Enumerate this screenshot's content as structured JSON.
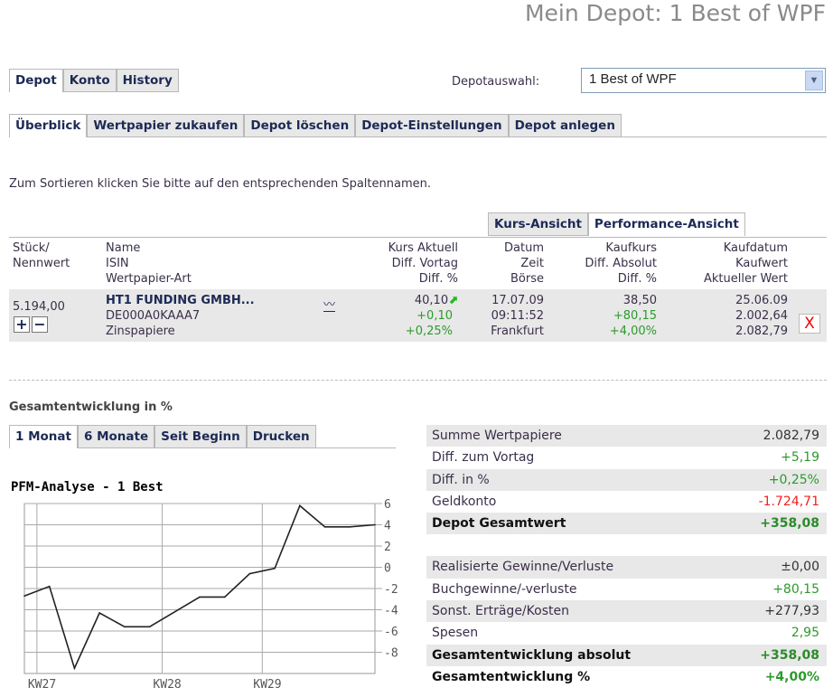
{
  "title": "Mein Depot: 1 Best of WPF",
  "main_tabs": [
    "Depot",
    "Konto",
    "History"
  ],
  "depot_select": {
    "label": "Depotauswahl:",
    "value": "1 Best of WPF"
  },
  "sub_tabs": [
    "Überblick",
    "Wertpapier zukaufen",
    "Depot löschen",
    "Depot-Einstellungen",
    "Depot anlegen"
  ],
  "hint": "Zum Sortieren klicken Sie bitte auf den entsprechenden Spaltennamen.",
  "view_tabs": [
    "Kurs-Ansicht",
    "Performance-Ansicht"
  ],
  "headers": {
    "stueck": [
      "Stück/",
      "Nennwert"
    ],
    "name": [
      "Name",
      "ISIN",
      "Wertpapier-Art"
    ],
    "kurs": [
      "Kurs Aktuell",
      "Diff. Vortag",
      "Diff. %"
    ],
    "datum": [
      "Datum",
      "Zeit",
      "Börse"
    ],
    "kaufkurs": [
      "Kaufkurs",
      "Diff. Absolut",
      "Diff. %"
    ],
    "kaufdatum": [
      "Kaufdatum",
      "Kaufwert",
      "Aktueller Wert"
    ]
  },
  "position": {
    "stueck": "5.194,00",
    "name": "HT1 FUNDING GMBH...",
    "isin": "DE000A0KAAA7",
    "art": "Zinspapiere",
    "kurs": "40,10",
    "diff_vortag": "+0,10",
    "diff_pct": "+0,25%",
    "datum": "17.07.09",
    "zeit": "09:11:52",
    "boerse": "Frankfurt",
    "kaufkurs": "38,50",
    "diff_abs": "+80,15",
    "diff_pct2": "+4,00%",
    "kaufdatum": "25.06.09",
    "kaufwert": "2.002,64",
    "aktueller_wert": "2.082,79",
    "plus": "+",
    "minus": "−",
    "delete": "X"
  },
  "gesamt_heading": "Gesamtentwicklung in %",
  "period_tabs": [
    "1 Monat",
    "6 Monate",
    "Seit Beginn",
    "Drucken"
  ],
  "summary1": [
    {
      "label": "Summe Wertpapiere",
      "value": "2.082,79",
      "color": "#333333"
    },
    {
      "label": "Diff. zum Vortag",
      "value": "+5,19",
      "color": "#2c9a2c"
    },
    {
      "label": "Diff. in %",
      "value": "+0,25%",
      "color": "#2c9a2c"
    },
    {
      "label": "Geldkonto",
      "value": "-1.724,71",
      "color": "#f02020"
    },
    {
      "label": "Depot Gesamtwert",
      "value": "+358,08",
      "color": "#2c8a2c",
      "bold": true
    }
  ],
  "summary2": [
    {
      "label": "Realisierte Gewinne/Verluste",
      "value": "±0,00",
      "color": "#333333"
    },
    {
      "label": "Buchgewinne/-verluste",
      "value": "+80,15",
      "color": "#2c9a2c"
    },
    {
      "label": "Sonst. Erträge/Kosten",
      "value": "+277,93",
      "color": "#333333"
    },
    {
      "label": "Spesen",
      "value": "2,95",
      "color": "#2c9a2c"
    },
    {
      "label": "Gesamtentwicklung absolut",
      "value": "+358,08",
      "color": "#2c8a2c",
      "bold": true
    },
    {
      "label": "Gesamtentwicklung %",
      "value": "+4,00%",
      "color": "#2c9a2c",
      "bold": true
    }
  ],
  "chart_data": {
    "type": "line",
    "title": "PFM-Analyse - 1 Best",
    "x": [
      0,
      1,
      2,
      3,
      4,
      5,
      7,
      8,
      9,
      10,
      11,
      12,
      13,
      14
    ],
    "y": [
      -2.7,
      -1.8,
      -9.5,
      -4.3,
      -5.6,
      -5.6,
      -2.8,
      -2.8,
      -0.6,
      -0.1,
      5.8,
      3.8,
      3.8,
      4.0
    ],
    "xlim": [
      0,
      14
    ],
    "ylim": [
      -10,
      6
    ],
    "yticks": [
      6,
      4,
      2,
      0,
      -2,
      -4,
      -6,
      -8
    ],
    "xticks": [
      {
        "x": 0.5,
        "label": "KW27"
      },
      {
        "x": 5.5,
        "label": "KW28"
      },
      {
        "x": 9.5,
        "label": "KW29"
      }
    ],
    "grid": true
  }
}
